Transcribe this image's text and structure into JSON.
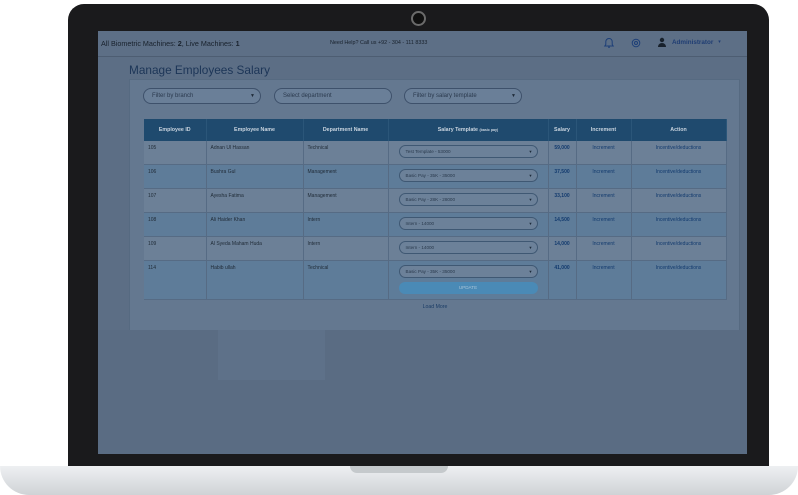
{
  "topbar": {
    "machines_prefix": "All Biometric Machines: ",
    "all_count": "2",
    "live_prefix": ", Live Machines: ",
    "live_count": "1",
    "help_text": "Need Help? Call us +92 - 304 - 111 8333",
    "admin_label": "Administrator"
  },
  "page": {
    "title": "Manage Employees Salary"
  },
  "filters": {
    "branch": "Filter by branch",
    "department": "Select department",
    "template": "Filter by salary template"
  },
  "table": {
    "headers": [
      "Employee ID",
      "Employee Name",
      "Department Name",
      "Salary Template",
      "Salary",
      "Increment",
      "Action"
    ],
    "template_header_note": "(basic pay)",
    "rows": [
      {
        "id": "105",
        "name": "Adnan Ul Hassan",
        "dept": "Technical",
        "template": "Test Template - 53000",
        "salary": "59,000",
        "increment": "Increment",
        "action": "Incentive/deductions"
      },
      {
        "id": "106",
        "name": "Bushra Gul",
        "dept": "Management",
        "template": "Basic Pay - 35K - 35000",
        "salary": "37,500",
        "increment": "Increment",
        "action": "Incentive/deductions"
      },
      {
        "id": "107",
        "name": "Ayesha Fatima",
        "dept": "Management",
        "template": "Basic Pay - 28K - 28000",
        "salary": "33,100",
        "increment": "Increment",
        "action": "Incentive/deductions"
      },
      {
        "id": "108",
        "name": "Ali Haider Khan",
        "dept": "Intern",
        "template": "Intern - 14000",
        "salary": "14,500",
        "increment": "Increment",
        "action": "Incentive/deductions"
      },
      {
        "id": "109",
        "name": "Al Syeda Maham Huda",
        "dept": "Intern",
        "template": "Intern - 14000",
        "salary": "14,000",
        "increment": "Increment",
        "action": "Incentive/deductions"
      },
      {
        "id": "114",
        "name": "Habib ullah",
        "dept": "Technical",
        "template": "Basic Pay - 35K - 35000",
        "salary": "41,000",
        "increment": "Increment",
        "action": "Incentive/deductions"
      }
    ],
    "update_label": "UPDATE",
    "load_more": "Load More"
  }
}
